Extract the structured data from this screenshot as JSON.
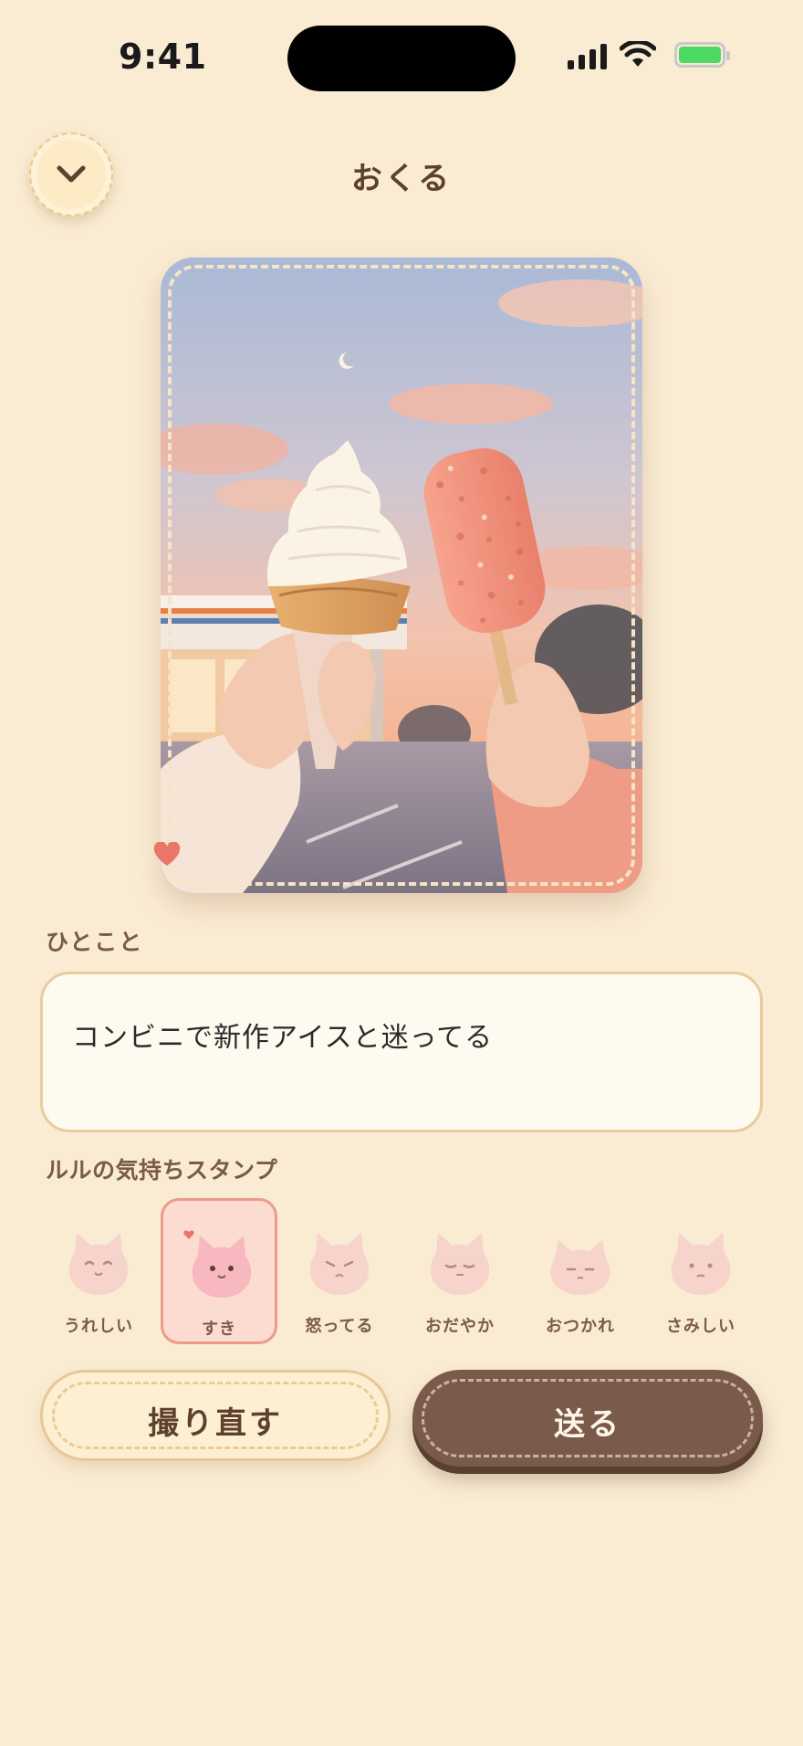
{
  "status_bar": {
    "time": "9:41"
  },
  "header": {
    "title": "おくる",
    "back_icon": "chevron-down-icon"
  },
  "photo": {
    "alt": ""
  },
  "message": {
    "label": "ひとこと",
    "value": "コンビニで新作アイスと迷ってる"
  },
  "stamps": {
    "label": "ルルの気持ちスタンプ",
    "items": [
      {
        "label": "うれしい",
        "selected": false
      },
      {
        "label": "すき",
        "selected": true
      },
      {
        "label": "怒ってる",
        "selected": false
      },
      {
        "label": "おだやか",
        "selected": false
      },
      {
        "label": "おつかれ",
        "selected": false
      },
      {
        "label": "さみしい",
        "selected": false
      }
    ]
  },
  "actions": {
    "retake_label": "撮り直す",
    "send_label": "送る"
  },
  "colors": {
    "background": "#faecd3",
    "accent_brown": "#7a5a4b",
    "selected_pink": "#fcdcd0",
    "heart": "#e8776a"
  }
}
